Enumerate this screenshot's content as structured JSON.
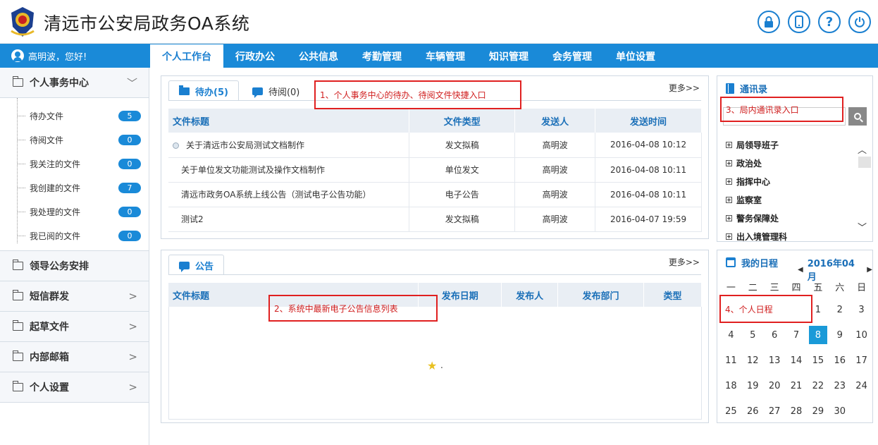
{
  "app": {
    "title": "清远市公安局政务OA系统"
  },
  "top_icons": [
    {
      "name": "lock-icon",
      "glyph": "🔒"
    },
    {
      "name": "mobile-icon",
      "glyph": "▯"
    },
    {
      "name": "help-icon",
      "glyph": "?"
    },
    {
      "name": "power-icon",
      "glyph": "⏻"
    }
  ],
  "user": {
    "greeting": "高明波，您好!"
  },
  "nav": {
    "tabs": [
      "个人工作台",
      "行政办公",
      "公共信息",
      "考勤管理",
      "车辆管理",
      "知识管理",
      "会务管理",
      "单位设置"
    ],
    "active": 0
  },
  "sidebar": {
    "personal_center": {
      "label": "个人事务中心",
      "items": [
        {
          "label": "待办文件",
          "count": "5"
        },
        {
          "label": "待阅文件",
          "count": "0"
        },
        {
          "label": "我关注的文件",
          "count": "0"
        },
        {
          "label": "我创建的文件",
          "count": "7"
        },
        {
          "label": "我处理的文件",
          "count": "0"
        },
        {
          "label": "我已阅的文件",
          "count": "0"
        }
      ]
    },
    "groups": [
      {
        "label": "领导公务安排",
        "chevron": ""
      },
      {
        "label": "短信群发",
        "chevron": ">"
      },
      {
        "label": "起草文件",
        "chevron": ">"
      },
      {
        "label": "内部邮箱",
        "chevron": ">"
      },
      {
        "label": "个人设置",
        "chevron": ">"
      }
    ]
  },
  "todo_panel": {
    "tabs": [
      "待办(5)",
      "待阅(0)"
    ],
    "more": "更多>>",
    "columns": [
      "文件标题",
      "文件类型",
      "发送人",
      "发送时间"
    ],
    "rows": [
      {
        "title": "关于清远市公安局测试文档制作",
        "type": "发文拟稿",
        "sender": "高明波",
        "time": "2016-04-08 10:12"
      },
      {
        "title": "关于单位发文功能测试及操作文档制作",
        "type": "单位发文",
        "sender": "高明波",
        "time": "2016-04-08 10:11"
      },
      {
        "title": "清远市政务OA系统上线公告（测试电子公告功能）",
        "type": "电子公告",
        "sender": "高明波",
        "time": "2016-04-08 10:11"
      },
      {
        "title": "测试2",
        "type": "发文拟稿",
        "sender": "高明波",
        "time": "2016-04-07 19:59"
      }
    ]
  },
  "notice_panel": {
    "tab": "公告",
    "more": "更多>>",
    "columns": [
      "文件标题",
      "发布日期",
      "发布人",
      "发布部门",
      "类型"
    ],
    "loading_mark": "."
  },
  "contacts": {
    "title": "通讯录",
    "search_placeholder": "",
    "departments": [
      "局领导班子",
      "政治处",
      "指挥中心",
      "监察室",
      "警务保障处",
      "出入境管理科"
    ]
  },
  "calendar": {
    "title": "我的日程",
    "month_label": "2016年04月",
    "weekdays": [
      "一",
      "二",
      "三",
      "四",
      "五",
      "六",
      "日"
    ],
    "days": [
      "",
      "",
      "",
      "",
      "1",
      "2",
      "3",
      "4",
      "5",
      "6",
      "7",
      "8",
      "9",
      "10",
      "11",
      "12",
      "13",
      "14",
      "15",
      "16",
      "17",
      "18",
      "19",
      "20",
      "21",
      "22",
      "23",
      "24",
      "25",
      "26",
      "27",
      "28",
      "29",
      "30"
    ],
    "today": "8"
  },
  "annotations": [
    "1、个人事务中心的待办、待阅文件快捷入口",
    "2、系统中最新电子公告信息列表",
    "3、局内通讯录入口",
    "4、个人日程"
  ],
  "colors": {
    "primary": "#1a8ad8",
    "annotation": "#e02020"
  }
}
